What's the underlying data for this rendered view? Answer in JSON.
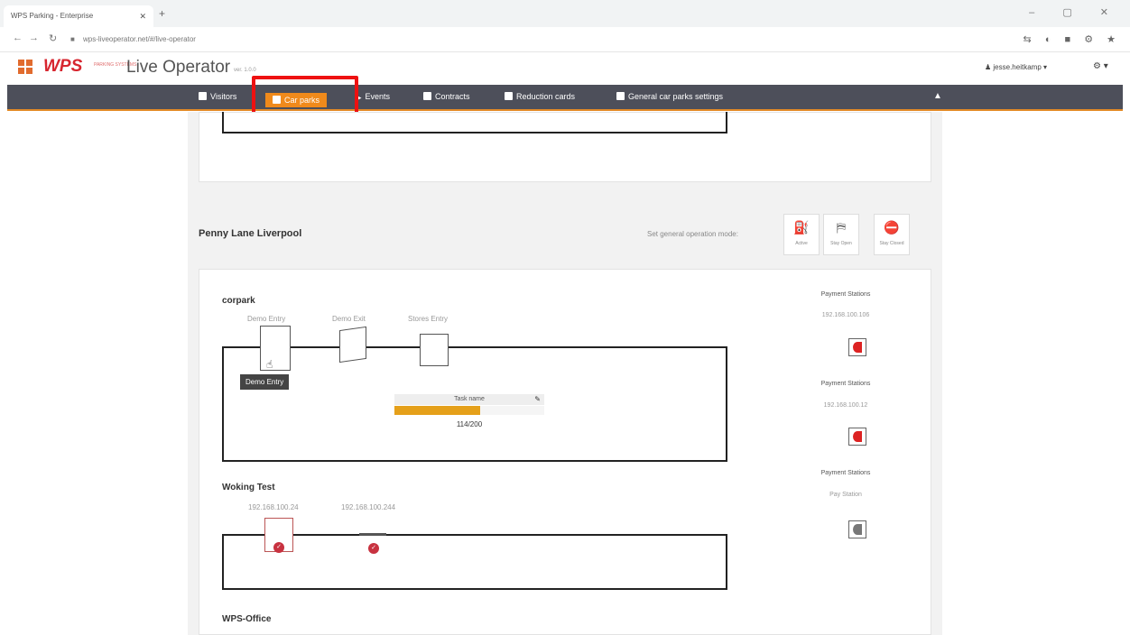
{
  "browser": {
    "tab_title": "WPS Parking - Enterprise",
    "url": "wps-liveoperator.net/#/live-operator",
    "window_controls": "– ▢ ✕",
    "extension_icons": "⇆ ◐ ■ ⚙ ★"
  },
  "app": {
    "logo": "WPS",
    "logo_sub": "PARKING SYSTEMS",
    "title": "Live Operator",
    "version": "ver. 1.0.0",
    "user": "jesse.heitkamp",
    "settings": "⚙ ▾"
  },
  "nav": {
    "items": [
      {
        "label": "Visitors"
      },
      {
        "label": "Car parks"
      },
      {
        "label": "Events"
      },
      {
        "label": "Contracts"
      },
      {
        "label": "Reduction cards"
      },
      {
        "label": "General car parks settings"
      }
    ]
  },
  "section": {
    "title": "Penny Lane Liverpool",
    "operation_mode_label": "Set general operation mode:",
    "modes": [
      {
        "label": "Active",
        "glyph": "⛽"
      },
      {
        "label": "Stay Open",
        "glyph": "⛿"
      },
      {
        "label": "Stay Closed",
        "glyph": "⛔"
      }
    ]
  },
  "carparks": [
    {
      "name": "corpark",
      "devices": [
        "Demo Entry",
        "Demo Exit",
        "Stores Entry"
      ],
      "tooltip": "Demo Entry",
      "task": {
        "name": "Task name",
        "count": "114/200",
        "progress": 0.57
      }
    },
    {
      "name": "Woking Test",
      "devices": [
        "192.168.100.24",
        "192.168.100.244"
      ]
    },
    {
      "name": "WPS-Office"
    }
  ],
  "payment_stations": [
    {
      "title": "Payment Stations",
      "ip": "192.168.100.106"
    },
    {
      "title": "Payment Stations",
      "ip": "192.168.100.12"
    },
    {
      "title": "Payment Stations",
      "ip": "Pay Station"
    }
  ],
  "colors": {
    "accent": "#f08a1b",
    "navbar": "#4d4f5a",
    "progress": "#e5a01a",
    "brand_red": "#d7262f"
  }
}
